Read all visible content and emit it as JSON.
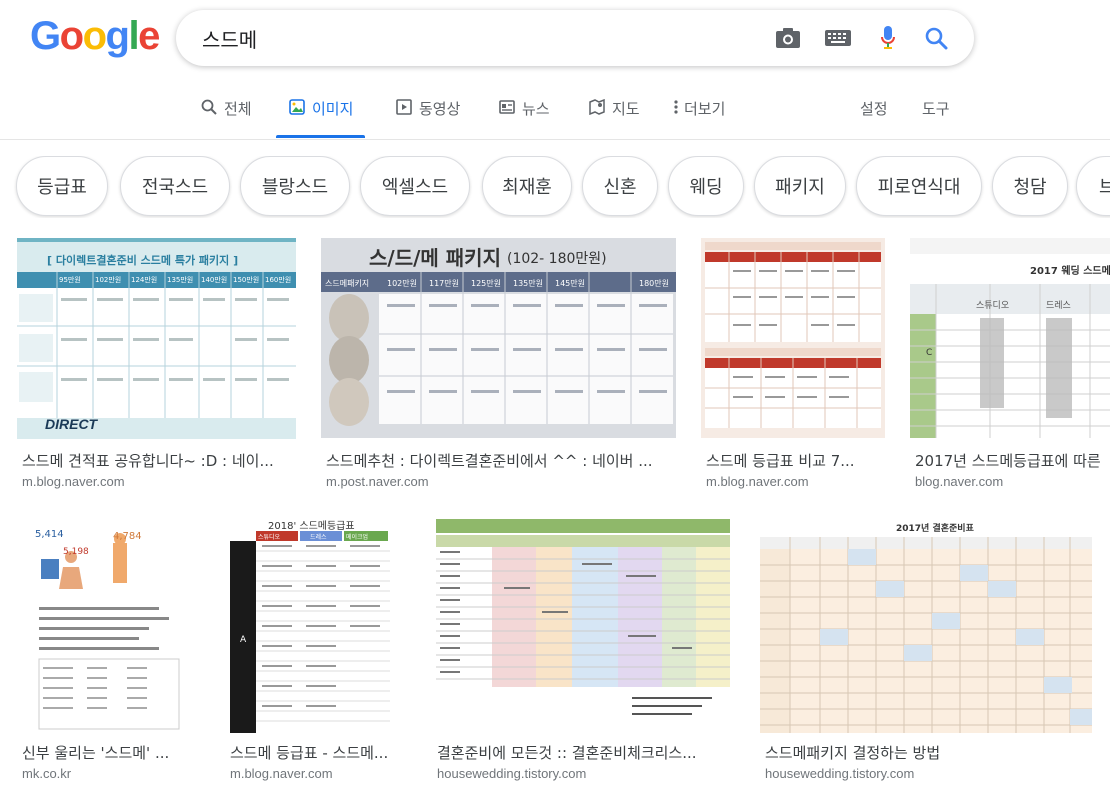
{
  "search": {
    "query": "스드메"
  },
  "logo": {
    "letters": [
      "G",
      "o",
      "o",
      "g",
      "l",
      "e"
    ],
    "colors": [
      "#4285F4",
      "#EA4335",
      "#FBBC05",
      "#4285F4",
      "#34A853",
      "#EA4335"
    ]
  },
  "tabs": [
    {
      "label": "전체",
      "icon": "search-icon"
    },
    {
      "label": "이미지",
      "icon": "image-icon",
      "active": true
    },
    {
      "label": "동영상",
      "icon": "video-icon"
    },
    {
      "label": "뉴스",
      "icon": "news-icon"
    },
    {
      "label": "지도",
      "icon": "map-icon"
    },
    {
      "label": "더보기",
      "icon": "more-vert-icon"
    }
  ],
  "tools": {
    "settings": "설정",
    "tools": "도구"
  },
  "chips": [
    "등급표",
    "전국스드",
    "블랑스드",
    "엑셀스드",
    "최재훈",
    "신혼",
    "웨딩",
    "패키지",
    "피로연식대",
    "청담",
    "브"
  ],
  "accent": "#1a73e8",
  "results": [
    {
      "title": "스드메 견적표 공유합니다~ :D : 네이...",
      "source": "m.blog.naver.com",
      "img": {
        "heading": "[ 다이렉트결혼준비 스드메 특가 패키지 ]",
        "cols": [
          "95만원",
          "102만원",
          "124만원",
          "135만원",
          "140만원",
          "150만원",
          "160만원"
        ],
        "brand": "DIRECT"
      }
    },
    {
      "title": "스드메추천 : 다이렉트결혼준비에서 ^^ : 네이버 ...",
      "source": "m.post.naver.com",
      "img": {
        "heading": "스/드/메 패키지",
        "sub": "(102- 180만원)",
        "cols": [
          "스드메패키지",
          "102만원",
          "117만원",
          "125만원",
          "135만원",
          "145만원",
          "180만원"
        ]
      }
    },
    {
      "title": "스드메 등급표 비교 7...",
      "source": "m.blog.naver.com"
    },
    {
      "title": "2017년 스드메등급표에 따른",
      "source": "blog.naver.com",
      "img": {
        "heading": "2017 웨딩 스드메",
        "labels": [
          "스튜디오",
          "드레스"
        ],
        "row_label": "C"
      }
    },
    {
      "title": "신부 울리는 '스드메' ...",
      "source": "mk.co.kr",
      "img": {
        "values": [
          "5,414",
          "4,784",
          "5,198"
        ]
      }
    },
    {
      "title": "스드메 등급표 - 스드메...",
      "source": "m.blog.naver.com",
      "img": {
        "heading": "2018' 스드메등급표",
        "heads": [
          "스튜디오",
          "드레스",
          "메이크업"
        ],
        "row_label": "A"
      }
    },
    {
      "title": "결혼준비에 모든것 :: 결혼준비체크리스...",
      "source": "housewedding.tistory.com"
    },
    {
      "title": "스드메패키지 결정하는 방법",
      "source": "housewedding.tistory.com",
      "img": {
        "heading": "2017년 결혼준비표"
      }
    }
  ]
}
